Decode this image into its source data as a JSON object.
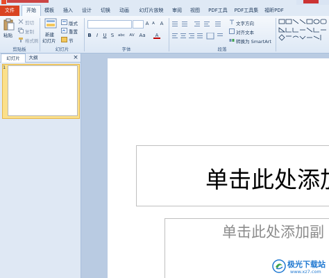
{
  "tabs": [
    "文件",
    "开始",
    "模板",
    "插入",
    "设计",
    "切换",
    "动画",
    "幻灯片放映",
    "审阅",
    "视图",
    "PDF工具",
    "PDF工具集",
    "福昕PDF"
  ],
  "clipboard": {
    "paste": "粘贴",
    "cut": "剪切",
    "copy": "复制",
    "format_painter": "格式刷",
    "group": "剪贴板"
  },
  "slides_group": {
    "new_slide_line1": "新建",
    "new_slide_line2": "幻灯片",
    "layout": "版式",
    "reset": "重置",
    "section": "节",
    "group": "幻灯片"
  },
  "font_group": {
    "bold": "B",
    "italic": "I",
    "underline": "U",
    "strike": "S",
    "shadow": "abc",
    "spacing": "AV",
    "case": "Aa",
    "grow": "A",
    "shrink": "A",
    "clear": "A",
    "color": "A",
    "group": "字体"
  },
  "paragraph_group": {
    "text_direction": "文字方向",
    "align_text": "对齐文本",
    "smartart": "转换为 SmartArt",
    "group": "段落"
  },
  "panel_tabs": {
    "slides": "幻灯片",
    "outline": "大纲",
    "close": "×"
  },
  "slide_number": "1",
  "slide": {
    "title_placeholder": "单击此处添加",
    "subtitle_placeholder": "单击此处添加副"
  },
  "watermark": {
    "name": "极光下载站",
    "url": "www.xz7.com"
  },
  "colors": {
    "file_tab": "#d94321",
    "ribbon": "#dde8f5",
    "work_bg": "#b9cbe2",
    "selected_thumb": "#fbe08b"
  }
}
